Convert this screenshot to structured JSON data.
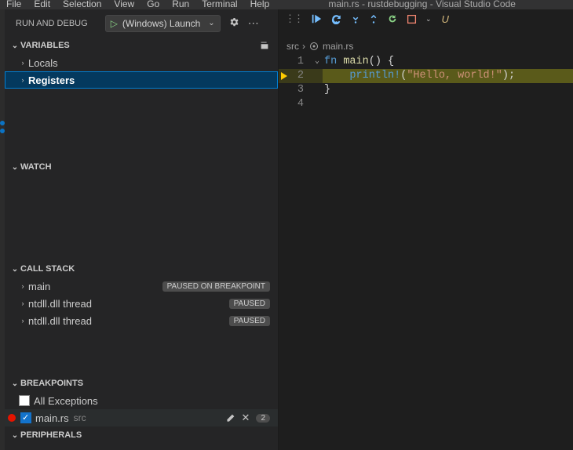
{
  "menubar": {
    "items": [
      "File",
      "Edit",
      "Selection",
      "View",
      "Go",
      "Run",
      "Terminal",
      "Help"
    ],
    "title": "main.rs - rustdebugging - Visual Studio Code"
  },
  "sidebar": {
    "title": "RUN AND DEBUG",
    "launchConfig": "(Windows) Launch",
    "sections": {
      "variables": {
        "label": "VARIABLES",
        "items": [
          {
            "label": "Locals"
          },
          {
            "label": "Registers",
            "selected": true
          }
        ]
      },
      "watch": {
        "label": "WATCH"
      },
      "callstack": {
        "label": "CALL STACK",
        "items": [
          {
            "label": "main",
            "status": "PAUSED ON BREAKPOINT"
          },
          {
            "label": "ntdll.dll thread",
            "status": "PAUSED"
          },
          {
            "label": "ntdll.dll thread",
            "status": "PAUSED"
          }
        ]
      },
      "breakpoints": {
        "label": "BREAKPOINTS",
        "allExceptions": "All Exceptions",
        "items": [
          {
            "file": "main.rs",
            "path": "src",
            "line": 2,
            "checked": true
          }
        ]
      },
      "peripherals": {
        "label": "PERIPHERALS"
      }
    }
  },
  "editor": {
    "breadcrumb": {
      "folder": "src",
      "file": "main.rs"
    },
    "debugToolbar": {
      "modifiedIndicator": "U"
    },
    "lines": [
      {
        "num": 1,
        "fold": true,
        "tokens": [
          [
            "kw",
            "fn "
          ],
          [
            "fn",
            "main"
          ],
          [
            "punct",
            "() {"
          ]
        ]
      },
      {
        "num": 2,
        "highlight": true,
        "breakpoint": true,
        "current": true,
        "tokens": [
          [
            "punct",
            "    "
          ],
          [
            "macro",
            "println!"
          ],
          [
            "punct",
            "("
          ],
          [
            "str",
            "\"Hello, world!\""
          ],
          [
            "punct",
            ");"
          ]
        ]
      },
      {
        "num": 3,
        "tokens": [
          [
            "punct",
            "}"
          ]
        ]
      },
      {
        "num": 4,
        "tokens": []
      }
    ]
  }
}
